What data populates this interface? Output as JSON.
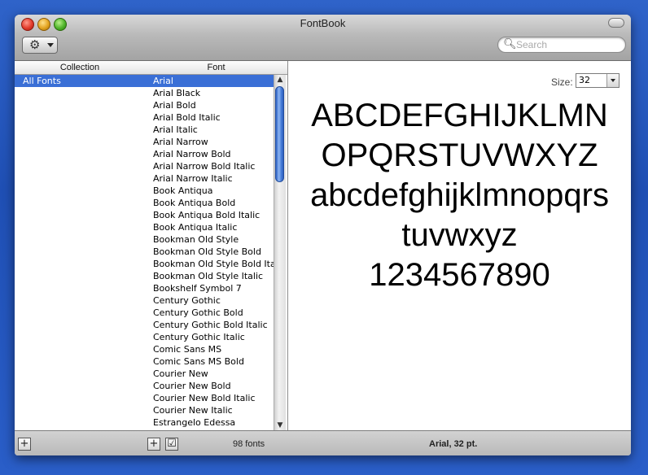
{
  "window": {
    "title": "FontBook"
  },
  "toolbar": {
    "action_icon": "gear-icon",
    "search": {
      "placeholder": "Search",
      "value": ""
    }
  },
  "collection": {
    "header": "Collection",
    "items": [
      {
        "label": "All Fonts",
        "selected": true
      }
    ]
  },
  "fonts": {
    "header": "Font",
    "items": [
      "Arial",
      "Arial Black",
      "Arial Bold",
      "Arial Bold Italic",
      "Arial Italic",
      "Arial Narrow",
      "Arial Narrow Bold",
      "Arial Narrow Bold Italic",
      "Arial Narrow Italic",
      "Book Antiqua",
      "Book Antiqua Bold",
      "Book Antiqua Bold Italic",
      "Book Antiqua Italic",
      "Bookman Old Style",
      "Bookman Old Style Bold",
      "Bookman Old Style Bold Itali",
      "Bookman Old Style Italic",
      "Bookshelf Symbol 7",
      "Century Gothic",
      "Century Gothic Bold",
      "Century Gothic Bold Italic",
      "Century Gothic Italic",
      "Comic Sans MS",
      "Comic Sans MS Bold",
      "Courier New",
      "Courier New Bold",
      "Courier New Bold Italic",
      "Courier New Italic",
      "Estrangelo Edessa"
    ],
    "selected_index": 0
  },
  "preview": {
    "size_label": "Size:",
    "size_value": "32",
    "lines": [
      "ABCDEFGHIJKLMN",
      "OPQRSTUVWXYZ",
      "abcdefghijklmnopqrs",
      "tuvwxyz",
      "1234567890"
    ]
  },
  "footer": {
    "font_count": "98 fonts",
    "status": "Arial, 32 pt.",
    "add_symbol": "+",
    "check_symbol": "☑"
  },
  "colors": {
    "selection": "#3a6fd6",
    "desktop": "#2a5ec8"
  }
}
